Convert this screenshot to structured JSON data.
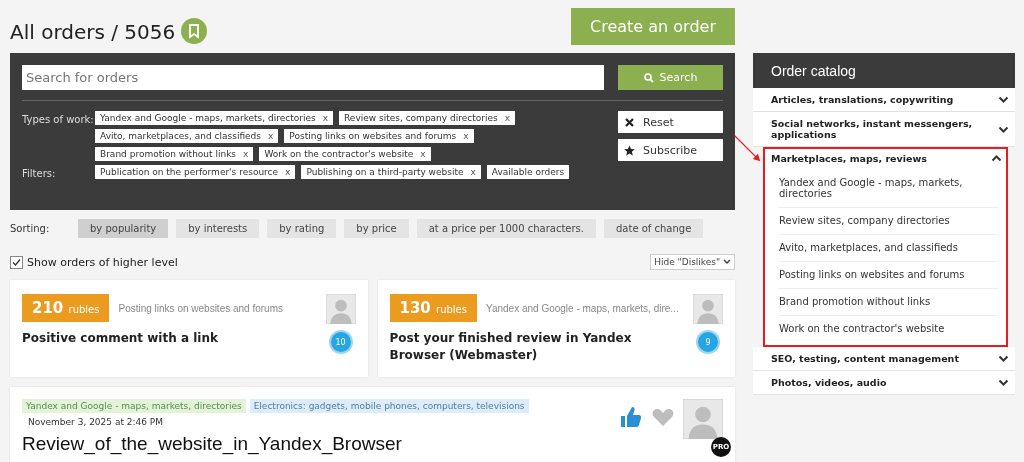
{
  "header": {
    "title": "All orders / 5056",
    "create_button": "Create an order"
  },
  "search": {
    "placeholder": "Search for orders",
    "button": "Search"
  },
  "filter_groups": [
    {
      "label": "Types of work:",
      "tags": [
        {
          "text": "Yandex and Google - maps, markets, directories",
          "remove": "x"
        },
        {
          "text": "Review sites, company directories",
          "remove": "x"
        },
        {
          "text": "Avito, marketplaces, and classifieds",
          "remove": "x"
        },
        {
          "text": "Posting links on websites and forums",
          "remove": "x"
        },
        {
          "text": "Brand promotion without links",
          "remove": "x"
        },
        {
          "text": "Work on the contractor's website",
          "remove": "x"
        }
      ]
    },
    {
      "label": "Filters:",
      "tags": [
        {
          "text": "Publication on the performer's resource",
          "remove": "x"
        },
        {
          "text": "Publishing on a third-party website",
          "remove": "x"
        },
        {
          "text": "Available orders"
        }
      ]
    }
  ],
  "filter_actions": [
    {
      "kind": "reset",
      "label": "Reset"
    },
    {
      "kind": "subscribe",
      "label": "Subscribe"
    }
  ],
  "sorting": {
    "label": "Sorting:",
    "options": [
      {
        "label": "by popularity",
        "selected": true
      },
      {
        "label": "by interests",
        "selected": false
      },
      {
        "label": "by rating",
        "selected": false
      },
      {
        "label": "by price",
        "selected": false
      },
      {
        "label": "at a price per 1000 characters.",
        "selected": false
      },
      {
        "label": "date of change",
        "selected": false
      }
    ]
  },
  "show_higher_level": {
    "label": "Show orders of higher level",
    "checked": true
  },
  "hide_dislikes": "Hide \"Dislikes\"",
  "cards": [
    {
      "price": "210",
      "unit": "rubles",
      "category": "Posting links on websites and forums",
      "title": "Positive comment with a link",
      "level": "10"
    },
    {
      "price": "130",
      "unit": "rubles",
      "category": "Yandex and Google - maps, markets, dire...",
      "title": "Post your finished review in Yandex Browser (Webmaster)",
      "level": "9"
    }
  ],
  "featured": {
    "tags": [
      {
        "text": "Yandex and Google - maps, markets, directories",
        "color": "#e3f3d8"
      },
      {
        "text": "Electronics: gadgets, mobile phones, computers, televisions",
        "color": "#dcecf8"
      }
    ],
    "date": "November 3, 2025 at 2:46 PM",
    "title": "Review_of_the_website_in_Yandex_Browser",
    "liked": true,
    "favorite": false,
    "badge": "PRO"
  },
  "catalog": {
    "title": "Order catalog",
    "sections": [
      {
        "label": "Articles, translations, copywriting",
        "expanded": false,
        "highlighted": false
      },
      {
        "label": "Social networks, instant messengers, applications",
        "expanded": false,
        "highlighted": false
      },
      {
        "label": "Marketplaces, maps, reviews",
        "expanded": true,
        "highlighted": true,
        "children": [
          {
            "label": "Yandex and Google - maps, markets, directories"
          },
          {
            "label": "Review sites, company directories"
          },
          {
            "label": "Avito, marketplaces, and classifieds"
          },
          {
            "label": "Posting links on websites and forums"
          },
          {
            "label": "Brand promotion without links"
          },
          {
            "label": "Work on the contractor's website"
          }
        ]
      },
      {
        "label": "SEO, testing, content management",
        "expanded": false,
        "highlighted": false
      },
      {
        "label": "Photos, videos, audio",
        "expanded": false,
        "highlighted": false
      }
    ]
  }
}
